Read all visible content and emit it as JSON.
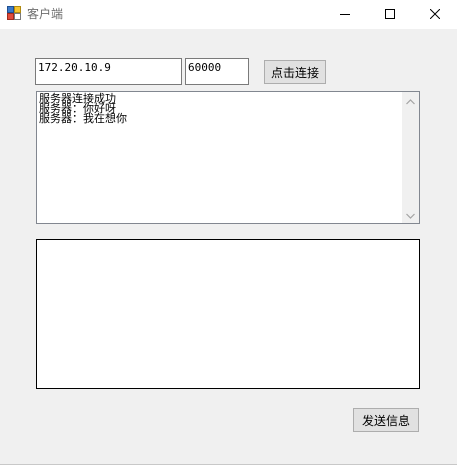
{
  "window": {
    "title": "客户端",
    "caption_buttons": [
      "minimize-icon",
      "maximize-icon",
      "close-icon"
    ]
  },
  "connection": {
    "ip_value": "172.20.10.9",
    "port_value": "60000",
    "connect_label": "点击连接"
  },
  "log": {
    "lines": [
      "服务器连接成功",
      "服务器：你好呀",
      "服务器：我在想你"
    ]
  },
  "message": {
    "value": ""
  },
  "actions": {
    "send_label": "发送信息"
  }
}
